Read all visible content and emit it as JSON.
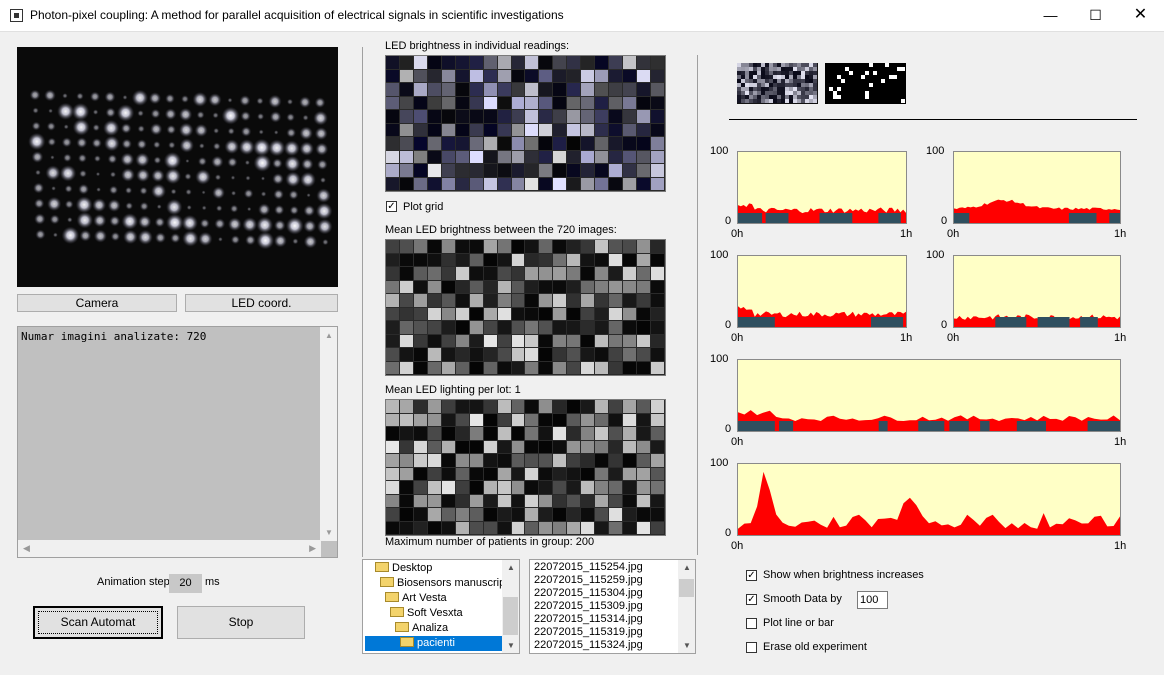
{
  "window": {
    "title": "Photon-pixel coupling: A method for parallel acquisition of electrical signals in scientific investigations"
  },
  "left": {
    "camera_button": "Camera",
    "led_coord_button": "LED coord.",
    "log_text": "Numar imagini analizate: 720",
    "animation_step_label": "Animation step",
    "animation_step_value": "20",
    "animation_step_unit": "ms",
    "scan_button": "Scan Automat",
    "stop_button": "Stop"
  },
  "middle": {
    "led_brightness_label": "LED brightness in individual readings:",
    "plot_grid_label": "Plot grid",
    "plot_grid_checked": true,
    "mean_brightness_label": "Mean LED brightness between the 720 images:",
    "mean_lighting_label": "Mean LED lighting per lot: 1",
    "max_patients_label": "Maximum number of patients in group: 200"
  },
  "folders": [
    {
      "name": "Desktop",
      "indent": 0
    },
    {
      "name": "Biosensors manuscript",
      "indent": 1
    },
    {
      "name": "Art Vesta",
      "indent": 2
    },
    {
      "name": "Soft Vesxta",
      "indent": 3
    },
    {
      "name": "Analiza",
      "indent": 4
    },
    {
      "name": "pacienti",
      "indent": 5,
      "selected": true
    }
  ],
  "files": [
    "22072015_115254.jpg",
    "22072015_115259.jpg",
    "22072015_115304.jpg",
    "22072015_115309.jpg",
    "22072015_115314.jpg",
    "22072015_115319.jpg",
    "22072015_115324.jpg"
  ],
  "plots": {
    "ymax_label": "100",
    "ymin_label": "0",
    "xmin_label": "0h",
    "xmax_label": "1h"
  },
  "options": {
    "show_increase_label": "Show when brightness increases",
    "show_increase_checked": true,
    "smooth_label": "Smooth Data by",
    "smooth_checked": true,
    "smooth_value": "100",
    "plot_line_label": "Plot line or bar",
    "plot_line_checked": false,
    "erase_label": "Erase old experiment",
    "erase_checked": false
  },
  "colors": {
    "plot_bg": "#ffffc6",
    "plot_fill": "#ff0000",
    "bar_fill": "#2f4f5f",
    "selection": "#0078d7"
  }
}
